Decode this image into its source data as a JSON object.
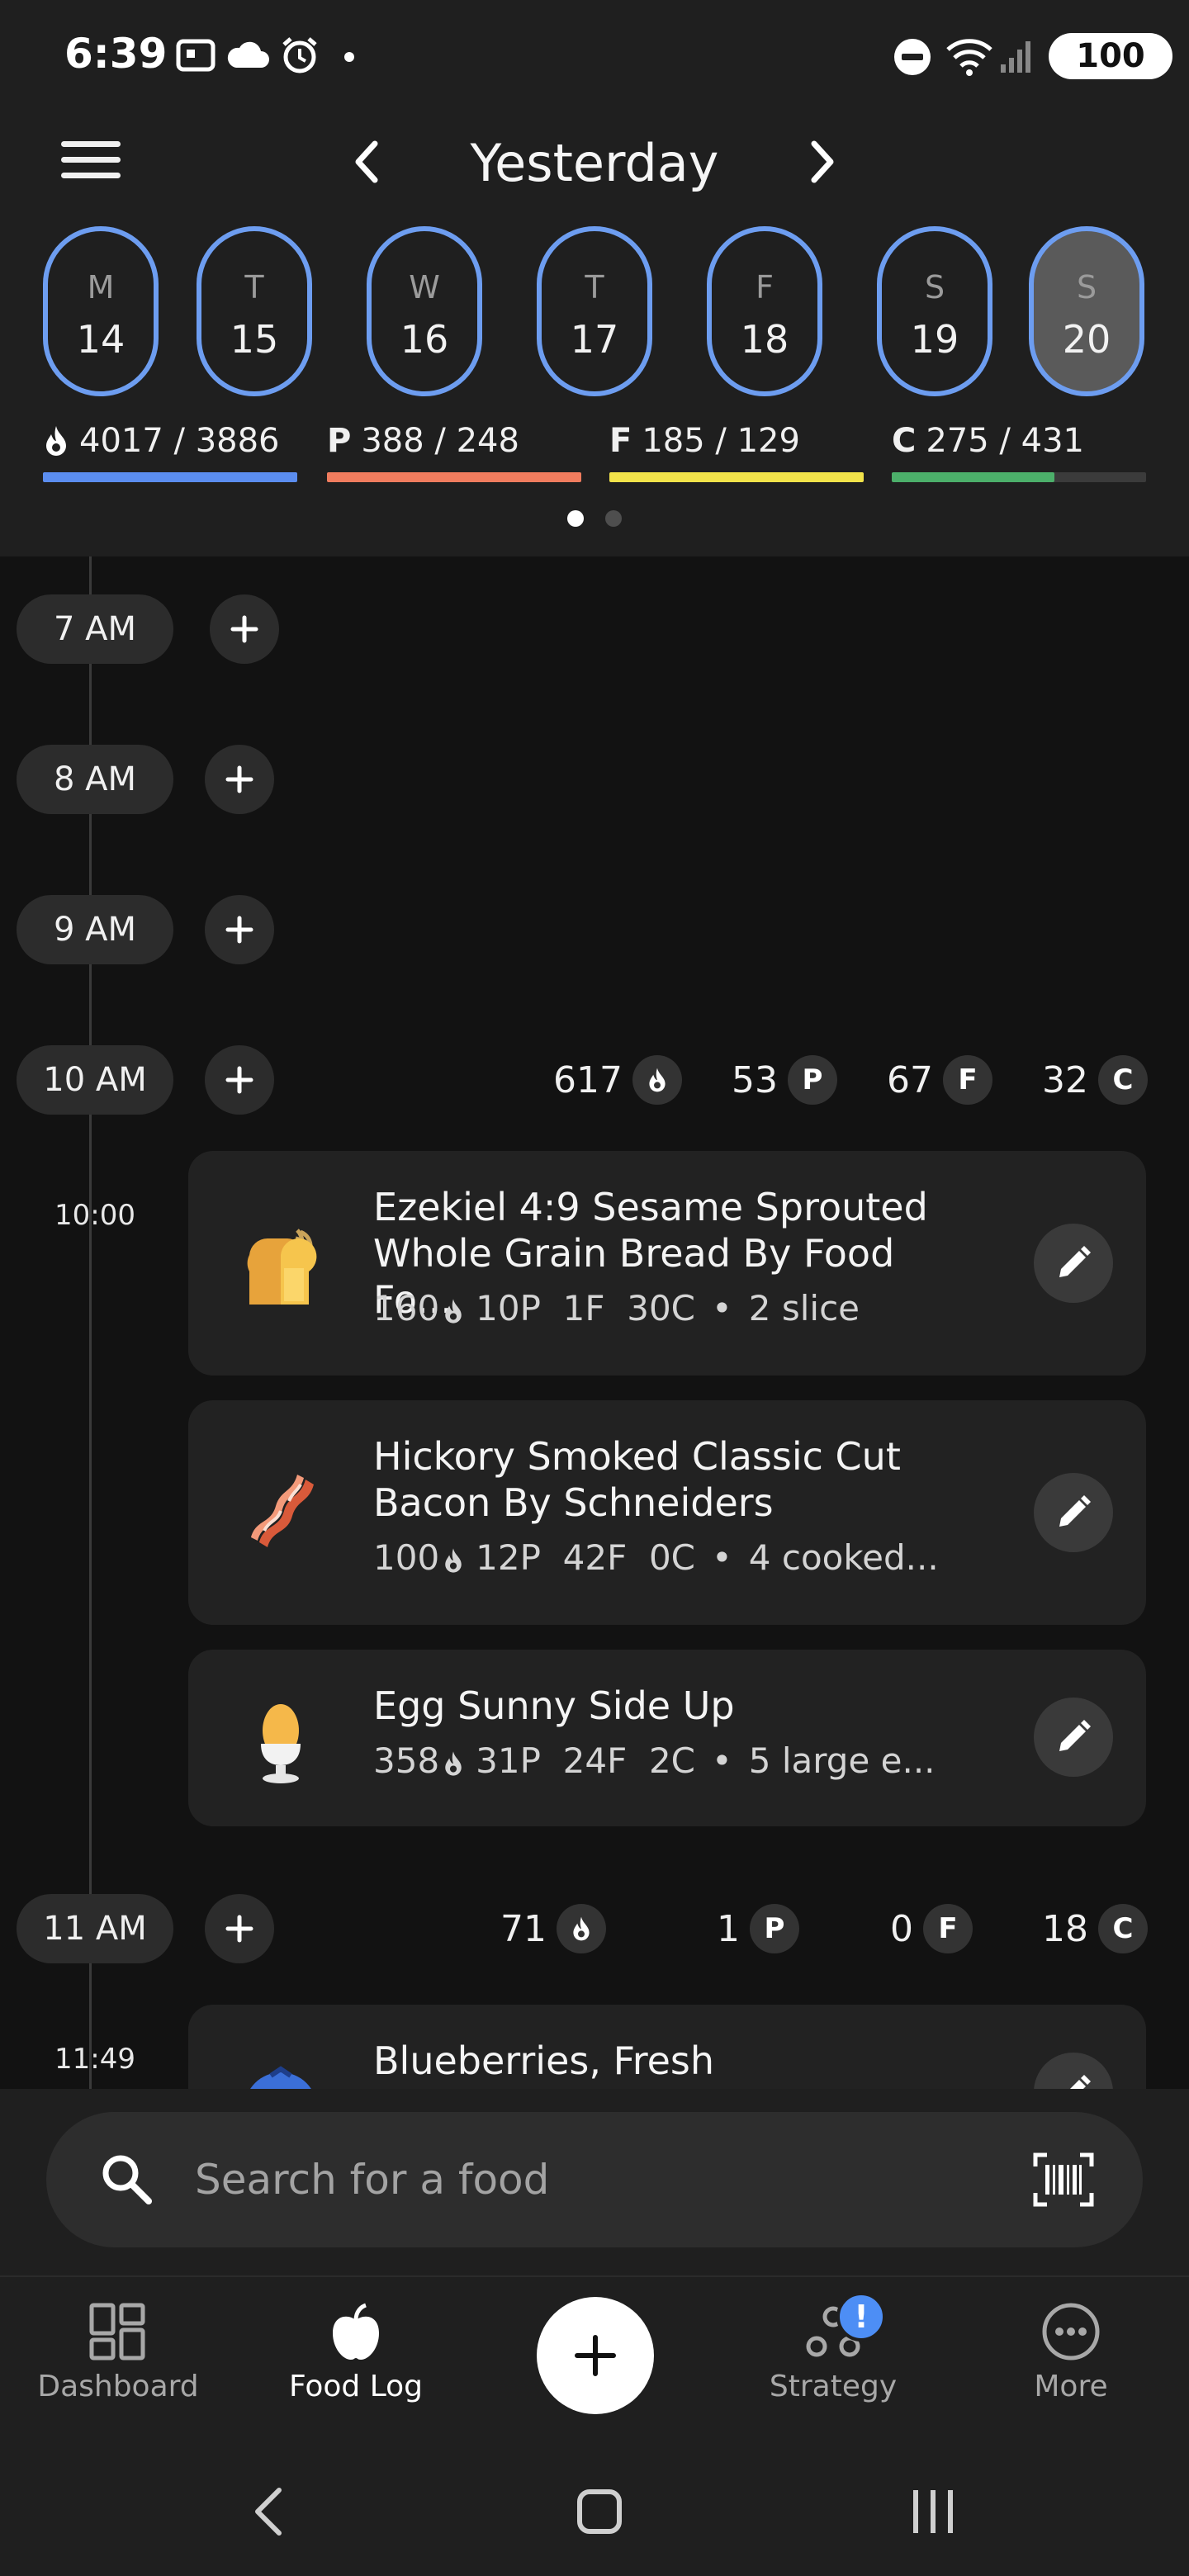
{
  "status_bar": {
    "time": "6:39",
    "battery": "100"
  },
  "header": {
    "title": "Yesterday"
  },
  "days": [
    {
      "letter": "M",
      "num": "14"
    },
    {
      "letter": "T",
      "num": "15"
    },
    {
      "letter": "W",
      "num": "16"
    },
    {
      "letter": "T",
      "num": "17"
    },
    {
      "letter": "F",
      "num": "18"
    },
    {
      "letter": "S",
      "num": "19"
    },
    {
      "letter": "S",
      "num": "20"
    }
  ],
  "macros": {
    "calories": {
      "value": "4017 / 3886",
      "progress": 1.0,
      "color": "#5b8def"
    },
    "protein": {
      "letter": "P",
      "value": "388 / 248",
      "progress": 1.0,
      "color": "#f07c5e"
    },
    "fat": {
      "letter": "F",
      "value": "185 / 129",
      "progress": 1.0,
      "color": "#f2e34a"
    },
    "carbs": {
      "letter": "C",
      "value": "275 / 431",
      "progress": 0.64,
      "color": "#4caf6a"
    }
  },
  "timeline": {
    "hours": {
      "h7": "7 AM",
      "h8": "8 AM",
      "h9": "9 AM",
      "h10": "10 AM",
      "h11": "11 AM"
    },
    "h10_totals": {
      "cal": "617",
      "p": "53",
      "f": "67",
      "c": "32"
    },
    "h11_totals": {
      "cal": "71",
      "p": "1",
      "f": "0",
      "c": "18"
    },
    "macro_badges": {
      "p": "P",
      "f": "F",
      "c": "C"
    },
    "entries": [
      {
        "time": "10:00",
        "name": "Ezekiel 4:9 Sesame Sprouted Whole Grain Bread By Food Fo...",
        "cal": "160",
        "macros": "10P  1F  30C",
        "serving": "2 slice"
      },
      {
        "name": "Hickory Smoked Classic Cut Bacon By Schneiders",
        "cal": "100",
        "macros": "12P  42F  0C",
        "serving": "4 cooked..."
      },
      {
        "name": "Egg Sunny Side Up",
        "cal": "358",
        "macros": "31P  24F  2C",
        "serving": "5 large e..."
      },
      {
        "time": "11:49",
        "name": "Blueberries, Fresh"
      }
    ]
  },
  "search": {
    "placeholder": "Search for a food"
  },
  "bottom_nav": {
    "dashboard": "Dashboard",
    "food_log": "Food Log",
    "strategy": "Strategy",
    "strategy_badge": "!",
    "more": "More"
  }
}
